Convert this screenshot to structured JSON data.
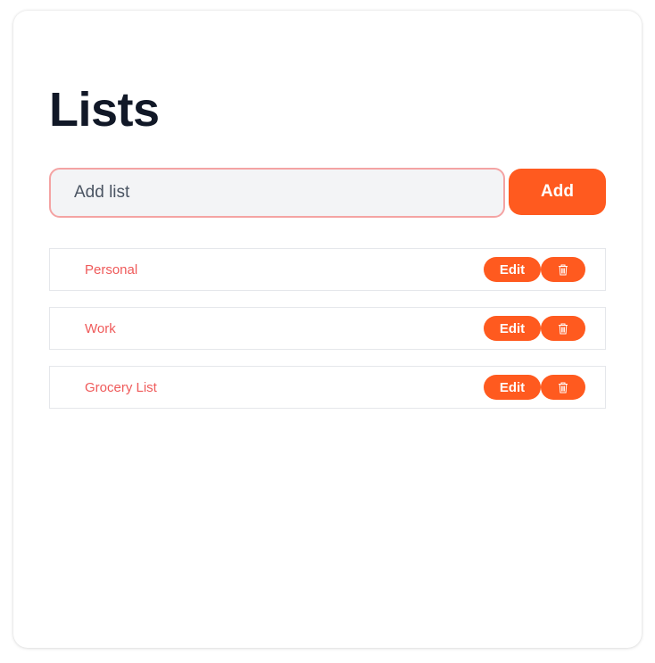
{
  "page": {
    "title": "Lists"
  },
  "add_form": {
    "input_value": "",
    "placeholder": "Add list",
    "button_label": "Add"
  },
  "lists": {
    "items": [
      {
        "name": "Personal",
        "edit_label": "Edit",
        "delete_icon": "trash-icon"
      },
      {
        "name": "Work",
        "edit_label": "Edit",
        "delete_icon": "trash-icon"
      },
      {
        "name": "Grocery List",
        "edit_label": "Edit",
        "delete_icon": "trash-icon"
      }
    ]
  },
  "colors": {
    "accent": "#ff5a1f",
    "item_text": "#ef5a5a",
    "title": "#111827",
    "input_border": "#f4a3a3",
    "input_bg": "#f3f4f6"
  }
}
